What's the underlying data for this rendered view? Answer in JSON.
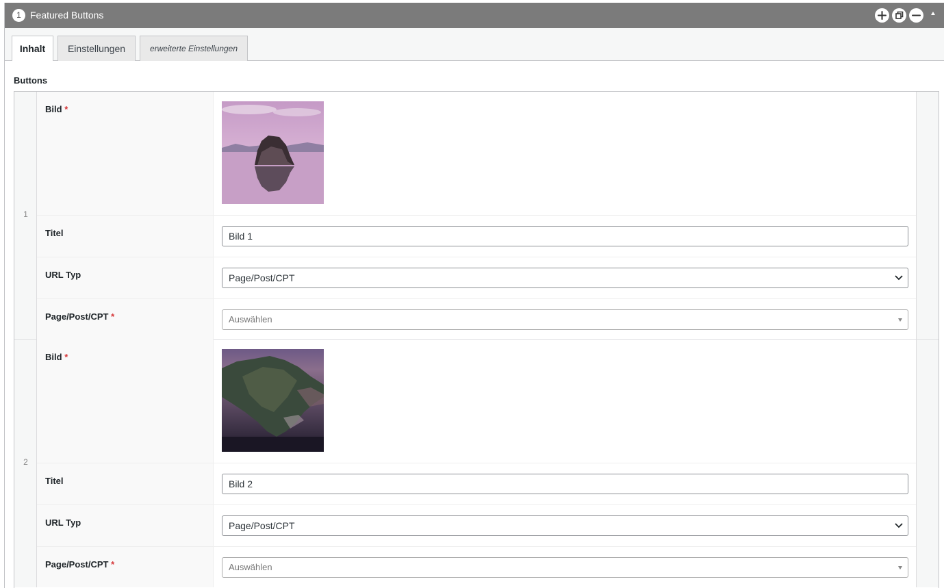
{
  "module": {
    "number": "1",
    "title": "Featured Buttons"
  },
  "tabs": [
    "Inhalt",
    "Einstellungen",
    "erweiterte Einstellungen"
  ],
  "section_label": "Buttons",
  "fields": {
    "image_label": "Bild",
    "title_label": "Titel",
    "url_type_label": "URL Typ",
    "page_label": "Page/Post/CPT",
    "required_mark": "*"
  },
  "rows": [
    {
      "index": "1",
      "title_value": "Bild 1",
      "url_type_value": "Page/Post/CPT",
      "page_placeholder": "Auswählen",
      "image": "pink-lake-rock"
    },
    {
      "index": "2",
      "title_value": "Bild 2",
      "url_type_value": "Page/Post/CPT",
      "page_placeholder": "Auswählen",
      "image": "dark-island-coast"
    }
  ],
  "colors": {
    "header_bg": "#7b7b7b",
    "required": "#d63638"
  }
}
